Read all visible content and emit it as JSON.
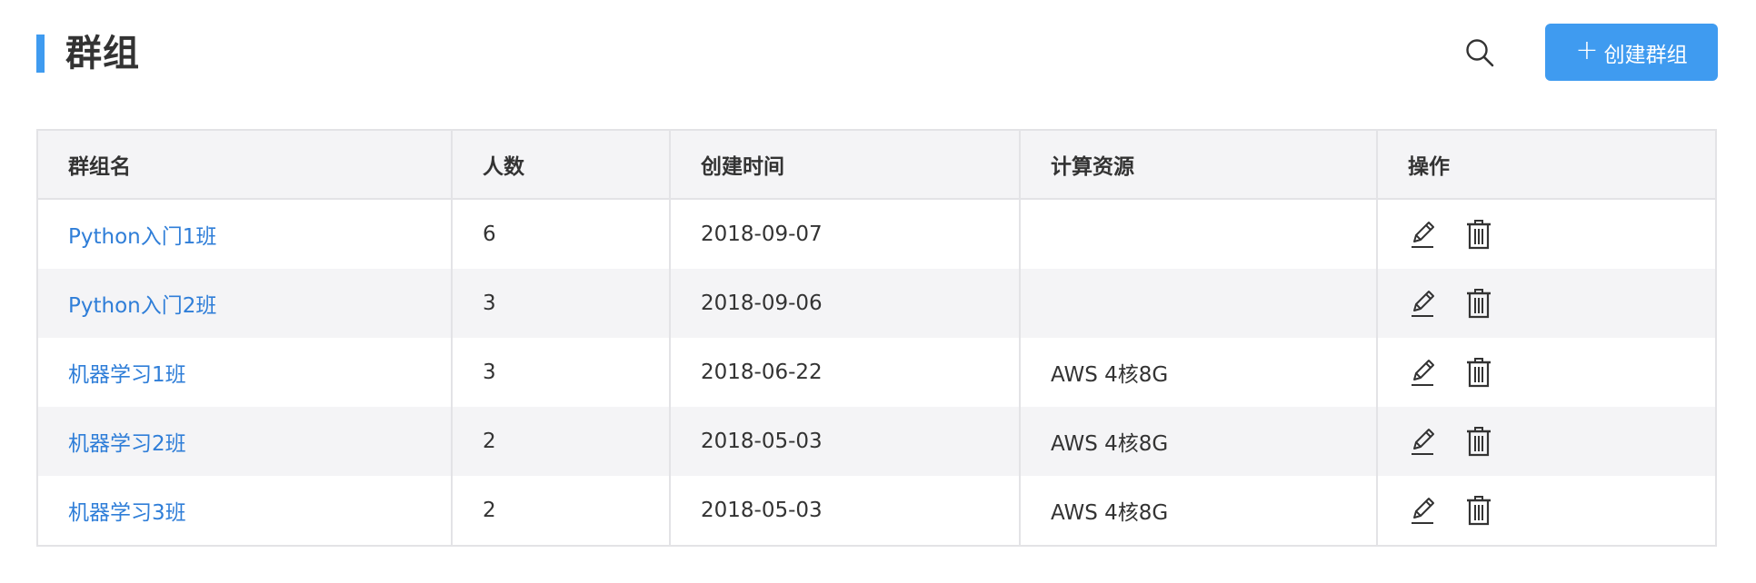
{
  "header": {
    "title": "群组",
    "search_icon": "search-icon",
    "create_button_icon": "plus-icon",
    "create_button_plus": "+",
    "create_button_label": "创建群组",
    "accent_color": "#3f9bf0"
  },
  "table": {
    "columns": [
      "群组名",
      "人数",
      "创建时间",
      "计算资源",
      "操作"
    ],
    "rows": [
      {
        "name": "Python入门1班",
        "members": "6",
        "created": "2018-09-07",
        "resource": ""
      },
      {
        "name": "Python入门2班",
        "members": "3",
        "created": "2018-09-06",
        "resource": ""
      },
      {
        "name": "机器学习1班",
        "members": "3",
        "created": "2018-06-22",
        "resource": "AWS 4核8G"
      },
      {
        "name": "机器学习2班",
        "members": "2",
        "created": "2018-05-03",
        "resource": "AWS 4核8G"
      },
      {
        "name": "机器学习3班",
        "members": "2",
        "created": "2018-05-03",
        "resource": "AWS 4核8G"
      }
    ],
    "row_action_icons": [
      "edit-icon",
      "trash-icon"
    ],
    "link_color": "#2f7ed8"
  }
}
